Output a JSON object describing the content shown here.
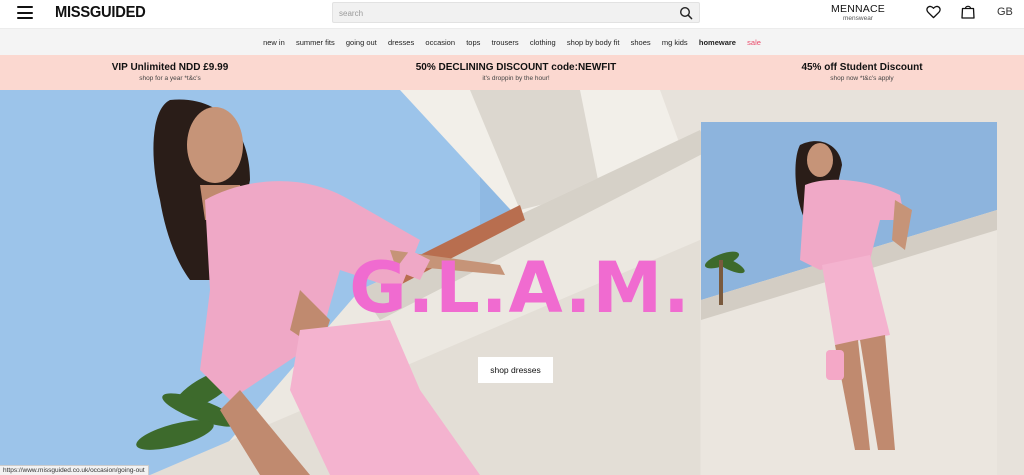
{
  "header": {
    "logo": "MISSGUIDED",
    "search_placeholder": "search",
    "mennace_title": "MENNACE",
    "mennace_sub": "menswear",
    "region": "GB"
  },
  "nav": {
    "items": [
      {
        "label": "new in"
      },
      {
        "label": "summer fits"
      },
      {
        "label": "going out"
      },
      {
        "label": "dresses"
      },
      {
        "label": "occasion"
      },
      {
        "label": "tops"
      },
      {
        "label": "trousers"
      },
      {
        "label": "clothing"
      },
      {
        "label": "shop by body fit"
      },
      {
        "label": "shoes"
      },
      {
        "label": "mg kids"
      },
      {
        "label": "homeware"
      },
      {
        "label": "sale"
      }
    ]
  },
  "promos": [
    {
      "title": "VIP Unlimited NDD £9.99",
      "sub": "shop for a year *t&c's"
    },
    {
      "title": "50% DECLINING DISCOUNT code:NEWFIT",
      "sub": "it's droppin by the hour!"
    },
    {
      "title": "45% off Student Discount",
      "sub": "shop now *t&c's apply"
    }
  ],
  "hero": {
    "headline": "G.L.A.M.",
    "cta": "shop dresses"
  },
  "status_bar": {
    "url": "https://www.missguided.co.uk/occasion/going-out"
  },
  "colors": {
    "promo_bg": "#fbd8d0",
    "headline": "#f06bd0",
    "sale": "#e94b6a",
    "nav_bg": "#f4f4f4"
  },
  "icons": [
    "hamburger-icon",
    "search-icon",
    "heart-icon",
    "bag-icon"
  ]
}
